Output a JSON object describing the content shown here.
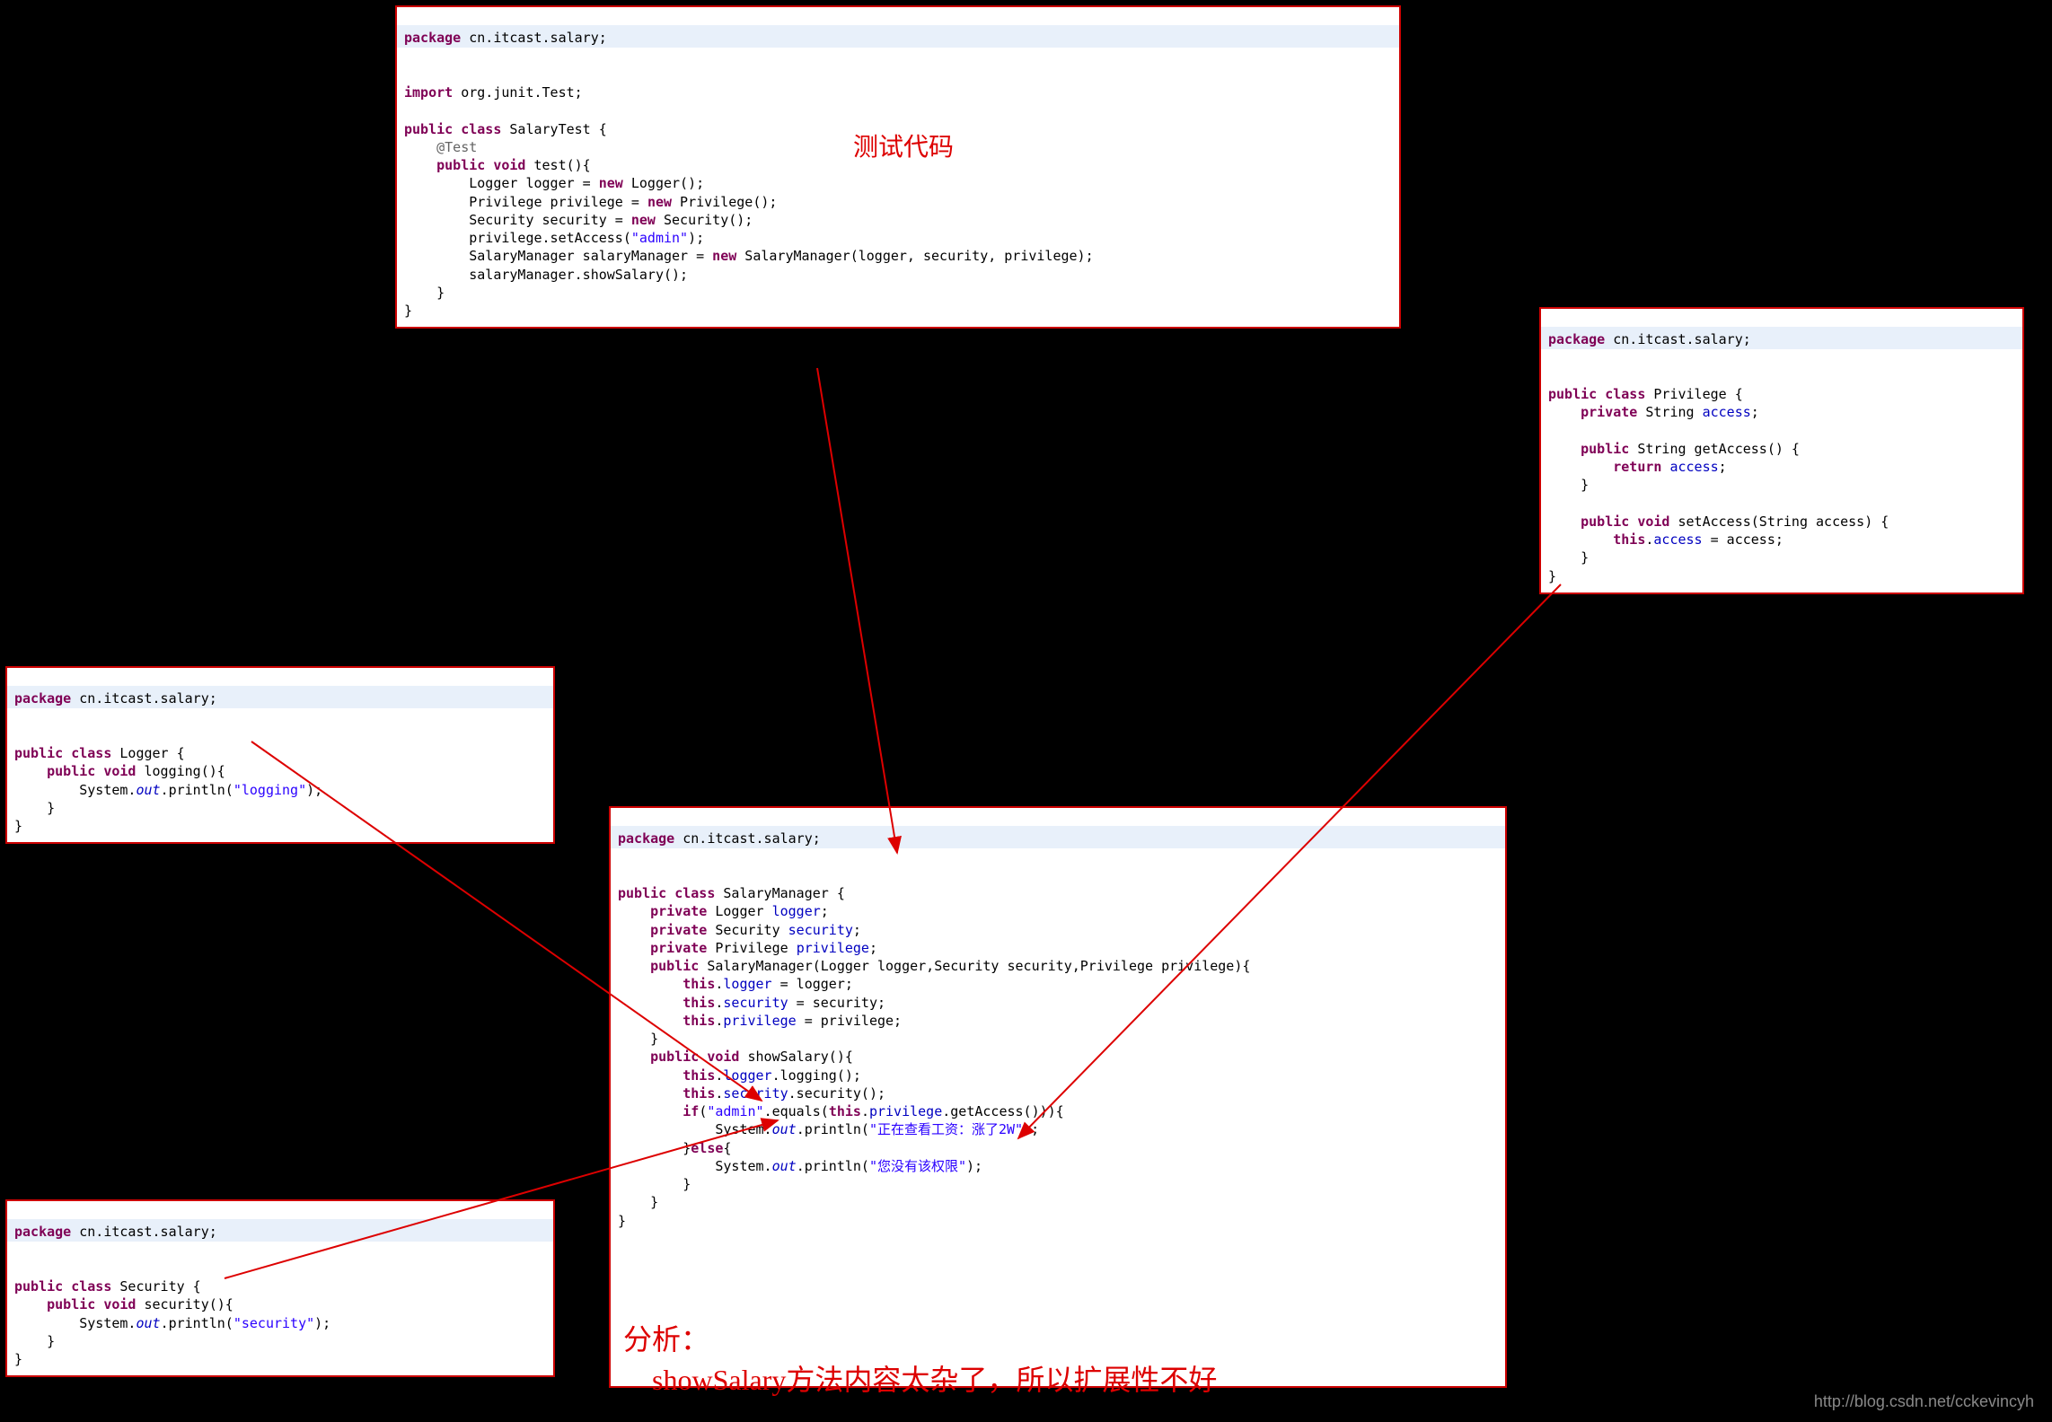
{
  "testBox": {
    "pkgLine": "package cn.itcast.salary;",
    "code": "\nimport org.junit.Test;\n\npublic class SalaryTest {\n    @Test\n    public void test(){\n        Logger logger = new Logger();\n        Privilege privilege = new Privilege();\n        Security security = new Security();\n        privilege.setAccess(\"admin\");\n        SalaryManager salaryManager = new SalaryManager(logger, security, privilege);\n        salaryManager.showSalary();\n    }\n}"
  },
  "loggerBox": {
    "pkgLine": "package cn.itcast.salary;",
    "code": "\npublic class Logger {\n    public void logging(){\n        System.out.println(\"logging\");\n    }\n}"
  },
  "securityBox": {
    "pkgLine": "package cn.itcast.salary;",
    "code": "\npublic class Security {\n    public void security(){\n        System.out.println(\"security\");\n    }\n}"
  },
  "privilegeBox": {
    "pkgLine": "package cn.itcast.salary;",
    "code": "\npublic class Privilege {\n    private String access;\n\n    public String getAccess() {\n        return access;\n    }\n\n    public void setAccess(String access) {\n        this.access = access;\n    }\n}"
  },
  "managerBox": {
    "pkgLine": "package cn.itcast.salary;",
    "code": "\npublic class SalaryManager {\n    private Logger logger;\n    private Security security;\n    private Privilege privilege;\n    public SalaryManager(Logger logger,Security security,Privilege privilege){\n        this.logger = logger;\n        this.security = security;\n        this.privilege = privilege;\n    }\n    public void showSalary(){\n        this.logger.logging();\n        this.security.security();\n        if(\"admin\".equals(this.privilege.getAccess())){\n            System.out.println(\"正在查看工资：涨了2W\");\n        }else{\n            System.out.println(\"您没有该权限\");\n        }\n    }\n}"
  },
  "labels": {
    "testLabel": "测试代码",
    "analysisPrefix": "分析：",
    "analysisText": "showSalary方法内容太杂了，所以扩展性不好"
  },
  "watermark": "http://blog.csdn.net/cckevincyh"
}
